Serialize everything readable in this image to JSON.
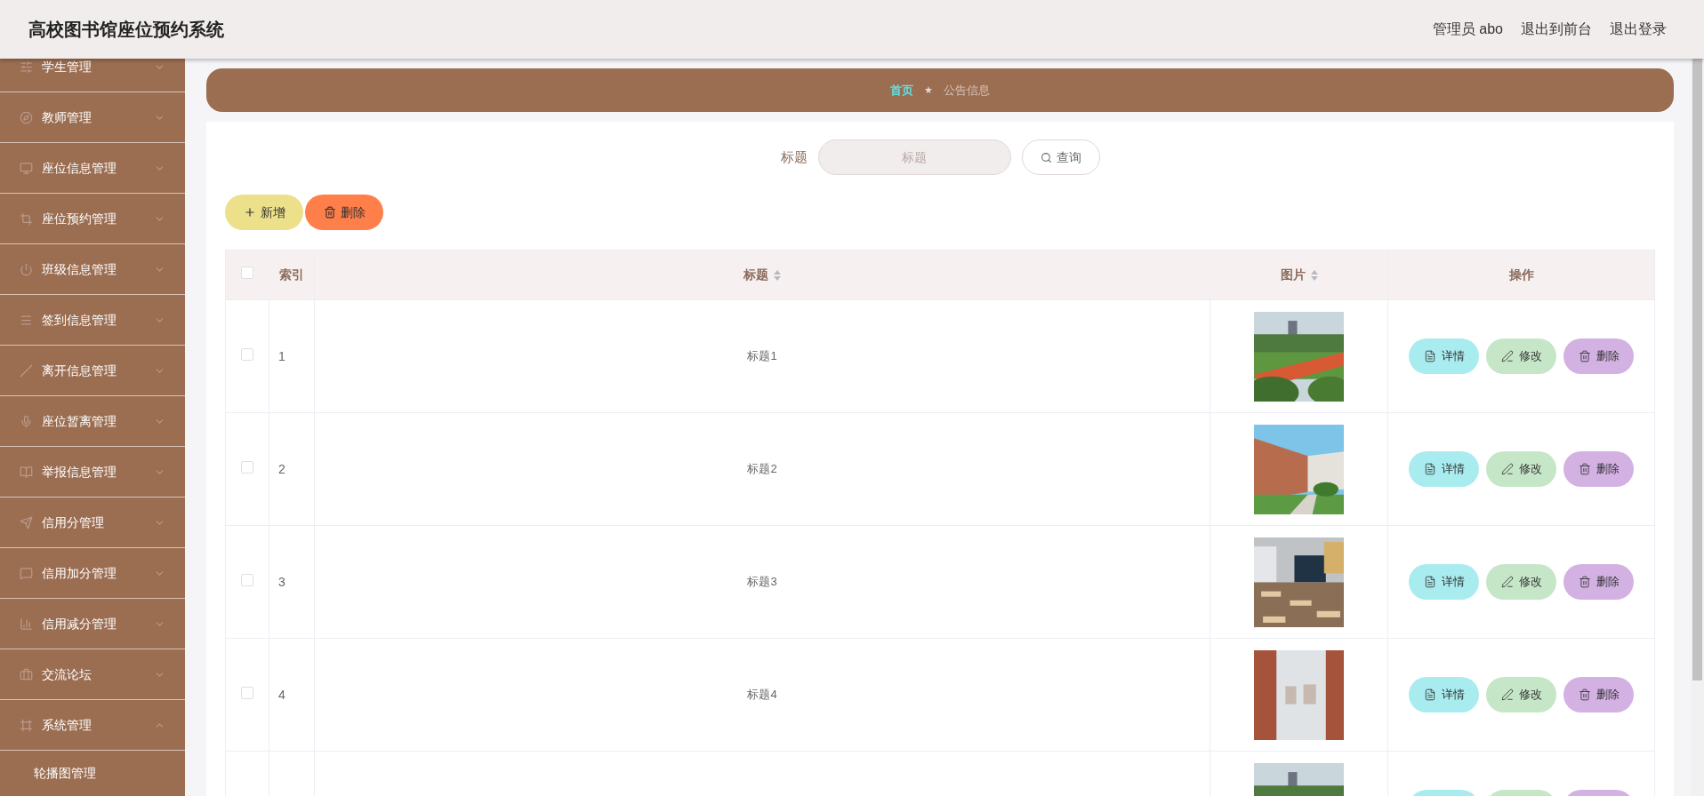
{
  "header": {
    "title": "高校图书馆座位预约系统",
    "links": [
      "管理员 abo",
      "退出到前台",
      "退出登录"
    ]
  },
  "sidebar": {
    "items": [
      {
        "label": "学生管理",
        "expanded": false
      },
      {
        "label": "教师管理",
        "expanded": false
      },
      {
        "label": "座位信息管理",
        "expanded": false
      },
      {
        "label": "座位预约管理",
        "expanded": false
      },
      {
        "label": "班级信息管理",
        "expanded": false
      },
      {
        "label": "签到信息管理",
        "expanded": false
      },
      {
        "label": "离开信息管理",
        "expanded": false
      },
      {
        "label": "座位暂离管理",
        "expanded": false
      },
      {
        "label": "举报信息管理",
        "expanded": false
      },
      {
        "label": "信用分管理",
        "expanded": false
      },
      {
        "label": "信用加分管理",
        "expanded": false
      },
      {
        "label": "信用减分管理",
        "expanded": false
      },
      {
        "label": "交流论坛",
        "expanded": false
      },
      {
        "label": "系统管理",
        "expanded": true,
        "children": [
          {
            "label": "轮播图管理"
          }
        ]
      }
    ]
  },
  "breadcrumb": {
    "separator": "★",
    "items": [
      {
        "label": "首页",
        "selected": true
      },
      {
        "label": "公告信息",
        "selected": false
      }
    ]
  },
  "search": {
    "label": "标题",
    "placeholder": "标题",
    "button": "查询"
  },
  "toolbar": [
    {
      "kind": "add",
      "label": "新增"
    },
    {
      "kind": "delete",
      "label": "删除"
    }
  ],
  "table": {
    "select_all": {
      "checked": false
    },
    "columns": [
      {
        "label": "索引",
        "sortable": false
      },
      {
        "label": "标题",
        "sortable": true
      },
      {
        "label": "图片",
        "sortable": true
      },
      {
        "label": "操作",
        "sortable": false
      }
    ],
    "rows": [
      {
        "checked": false,
        "index": "1",
        "title": "标题1",
        "picture": {
          "kind": "picture"
        },
        "actions": [
          {
            "kind": "detail",
            "label": "详情"
          },
          {
            "kind": "edit",
            "label": "修改"
          },
          {
            "kind": "delete",
            "label": "删除"
          }
        ]
      },
      {
        "checked": false,
        "index": "2",
        "title": "标题2",
        "picture": {
          "kind": "picture"
        },
        "actions": [
          {
            "kind": "detail",
            "label": "详情"
          },
          {
            "kind": "edit",
            "label": "修改"
          },
          {
            "kind": "delete",
            "label": "删除"
          }
        ]
      },
      {
        "checked": false,
        "index": "3",
        "title": "标题3",
        "picture": {
          "kind": "picture"
        },
        "actions": [
          {
            "kind": "detail",
            "label": "详情"
          },
          {
            "kind": "edit",
            "label": "修改"
          },
          {
            "kind": "delete",
            "label": "删除"
          }
        ]
      },
      {
        "checked": false,
        "index": "4",
        "title": "标题4",
        "picture": {
          "kind": "picture"
        },
        "actions": [
          {
            "kind": "detail",
            "label": "详情"
          },
          {
            "kind": "edit",
            "label": "修改"
          },
          {
            "kind": "delete",
            "label": "删除"
          }
        ]
      },
      {
        "picture": {
          "kind": "picture"
        },
        "actions": [
          {
            "kind": "detail"
          },
          {
            "kind": "edit"
          },
          {
            "kind": "delete"
          }
        ]
      }
    ]
  }
}
